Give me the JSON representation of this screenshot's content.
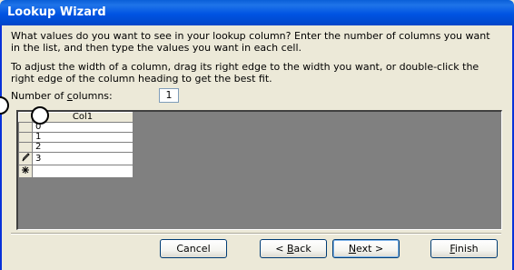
{
  "window": {
    "title": "Lookup Wizard"
  },
  "instructions": {
    "line1": "What values do you want to see in your lookup column? Enter the number of columns you want in the list, and then type the values you want in each cell.",
    "line2": "To adjust the width of a column, drag its right edge to the width you want, or double-click the right edge of the column heading to get the best fit."
  },
  "columns_field": {
    "label_pre": "Number of ",
    "label_hotkey": "c",
    "label_post": "olumns:",
    "value": "1"
  },
  "grid": {
    "column_header": "Col1",
    "rows": [
      {
        "selector": "",
        "value": "0"
      },
      {
        "selector": "",
        "value": "1"
      },
      {
        "selector": "",
        "value": "2"
      },
      {
        "selector": "pencil-icon",
        "value": "3"
      },
      {
        "selector": "new-record-icon",
        "value": ""
      }
    ]
  },
  "buttons": {
    "cancel": "Cancel",
    "back_pre": "< ",
    "back_hotkey": "B",
    "back_post": "ack",
    "next_hotkey": "N",
    "next_post": "ext >",
    "finish_hotkey": "F",
    "finish_post": "inish"
  }
}
